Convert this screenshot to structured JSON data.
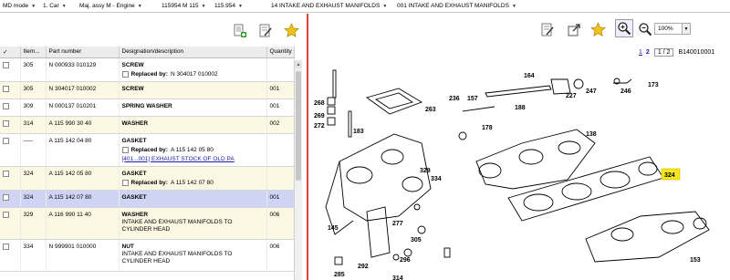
{
  "breadcrumb": [
    {
      "label": "MD mode"
    },
    {
      "label": "1. Car"
    },
    {
      "label": "Maj. assy M - Engine"
    },
    {
      "label": "115954 M 115"
    },
    {
      "label": "115.954"
    },
    {
      "label": "14 INTAKE AND EXHAUST MANIFOLDS"
    },
    {
      "label": "001 INTAKE AND EXHAUST MANIFOLDS"
    }
  ],
  "left_toolbar": {
    "icons": [
      "add-to-list-icon",
      "notes-icon",
      "favorite-star-icon"
    ]
  },
  "table": {
    "headers": {
      "check": "✓",
      "item": "Item...",
      "part": "Part number",
      "desc": "Designation/description",
      "qty": "Quantity"
    },
    "rows": [
      {
        "item": "305",
        "part": "N 000933 010129",
        "desc": "SCREW",
        "qty": "",
        "replaced_label": "Replaced by:",
        "replaced_value": "N 304017 010002",
        "link": ""
      },
      {
        "item": "305",
        "part": "N 304017 010002",
        "desc": "SCREW",
        "qty": "001",
        "replaced_label": "",
        "replaced_value": "",
        "link": ""
      },
      {
        "item": "309",
        "part": "N 000137 010201",
        "desc": "SPRING WASHER",
        "qty": "001",
        "replaced_label": "",
        "replaced_value": "",
        "link": ""
      },
      {
        "item": "314",
        "part": "A 115 990 30 40",
        "desc": "WASHER",
        "qty": "002",
        "replaced_label": "",
        "replaced_value": "",
        "link": ""
      },
      {
        "item": "-----",
        "part": "A 115 142 04 80",
        "desc": "GASKET",
        "qty": "",
        "replaced_label": "Replaced by:",
        "replaced_value": "A 115 142 05 80",
        "link": "[401...001] EXHAUST STOCK OF OLD PA"
      },
      {
        "item": "324",
        "part": "A 115 142 05 80",
        "desc": "GASKET",
        "qty": "",
        "replaced_label": "Replaced by:",
        "replaced_value": "A 115 142 07 80",
        "link": ""
      },
      {
        "item": "324",
        "part": "A 115 142 07 80",
        "desc": "GASKET",
        "qty": "001",
        "replaced_label": "",
        "replaced_value": "",
        "link": ""
      },
      {
        "item": "329",
        "part": "A 116 990 11 40",
        "desc": "WASHER",
        "qty": "006",
        "replaced_label": "",
        "replaced_value": "",
        "link": "",
        "note1": "INTAKE AND EXHAUST MANIFOLDS TO",
        "note2": "CYLINDER HEAD"
      },
      {
        "item": "334",
        "part": "N 999901 010000",
        "desc": "NUT",
        "qty": "006",
        "replaced_label": "",
        "replaced_value": "",
        "link": "",
        "note1": "INTAKE AND EXHAUST MANIFOLDS TO",
        "note2": "CYLINDER HEAD"
      }
    ]
  },
  "right_toolbar": {
    "icons": [
      "notes-icon",
      "open-window-icon",
      "favorite-star-icon",
      "zoom-in-icon",
      "zoom-out-icon"
    ],
    "zoom_value": "100%"
  },
  "pagination": {
    "page1": "1",
    "page2": "2",
    "page_of": "1 / 2",
    "drawing_id": "B140010001"
  },
  "drawing": {
    "callouts": [
      "268",
      "269",
      "272",
      "263",
      "236",
      "157",
      "188",
      "164",
      "247",
      "227",
      "246",
      "173",
      "183",
      "178",
      "138",
      "329",
      "334",
      "324",
      "145",
      "277",
      "153",
      "305",
      "296",
      "314",
      "285",
      "292"
    ],
    "highlight_callout": "324",
    "highlight_color": "#f4e81c"
  },
  "colors": {
    "selected_row": "#d0d4f4",
    "alt_row": "#fbf8e3",
    "link": "#1a1aa6",
    "divider": "#dd4444"
  }
}
